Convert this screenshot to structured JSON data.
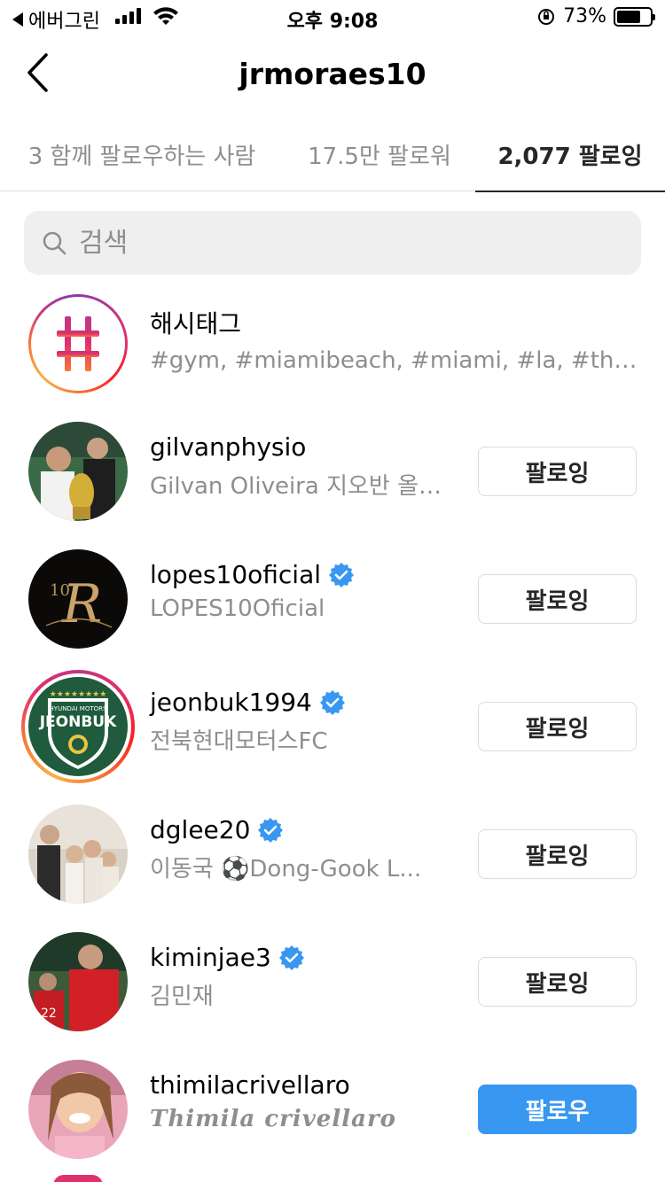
{
  "status_bar": {
    "carrier": "에버그린",
    "time": "오후 9:08",
    "battery_percent": "73%",
    "battery_level": 0.73
  },
  "header": {
    "title": "jrmoraes10"
  },
  "tabs": [
    {
      "label": "3 함께 팔로우하는 사람",
      "active": false
    },
    {
      "label": "17.5만 팔로워",
      "active": false
    },
    {
      "label": "2,077 팔로잉",
      "active": true
    }
  ],
  "search": {
    "placeholder": "검색"
  },
  "hashtags_row": {
    "title": "해시태그",
    "subtitle": "#gym, #miamibeach, #miami, #la, #thisis..."
  },
  "users": [
    {
      "username": "gilvanphysio",
      "fullname": "Gilvan Oliveira 지오반 올…",
      "verified": false,
      "button": "팔로잉"
    },
    {
      "username": "lopes10oficial",
      "fullname": "LOPES10Oficial",
      "verified": true,
      "button": "팔로잉"
    },
    {
      "username": "jeonbuk1994",
      "fullname": "전북현대모터스FC",
      "verified": true,
      "button": "팔로잉"
    },
    {
      "username": "dglee20",
      "fullname": "이동국 ⚽Dong-Gook L...",
      "verified": true,
      "button": "팔로잉"
    },
    {
      "username": "kiminjae3",
      "fullname": "김민재",
      "verified": true,
      "button": "팔로잉"
    },
    {
      "username": "thimilacrivellaro",
      "fullname": "Thimila crivellaro",
      "verified": false,
      "button": "팔로우"
    }
  ],
  "colors": {
    "follow_blue": "#3897f0",
    "verified_blue": "#3897f0",
    "text_primary": "#262626",
    "text_secondary": "#8e8e8e"
  }
}
